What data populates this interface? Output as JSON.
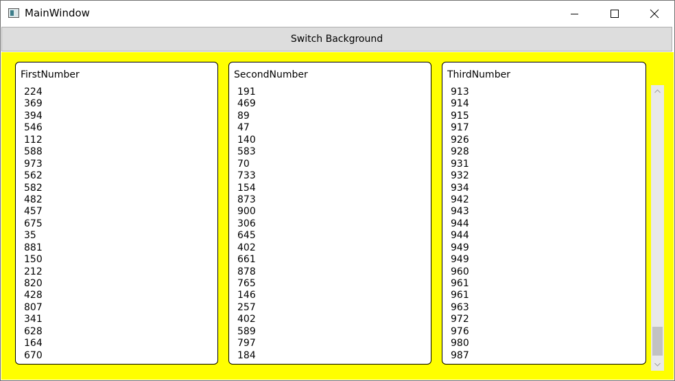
{
  "window": {
    "title": "MainWindow",
    "icon": "app-window-icon"
  },
  "titlebar_buttons": {
    "minimize_icon": "minimize-icon",
    "maximize_icon": "maximize-icon",
    "close_icon": "close-icon"
  },
  "toolbar": {
    "switch_label": "Switch Background"
  },
  "colors": {
    "content_background": "#ffff00",
    "button_background": "#dddddd"
  },
  "panels": [
    {
      "header": "FirstNumber",
      "values": [
        "224",
        "369",
        "394",
        "546",
        "112",
        "588",
        "973",
        "562",
        "582",
        "482",
        "457",
        "675",
        "35",
        "881",
        "150",
        "212",
        "820",
        "428",
        "807",
        "341",
        "628",
        "164",
        "670"
      ]
    },
    {
      "header": "SecondNumber",
      "values": [
        "191",
        "469",
        "89",
        "47",
        "140",
        "583",
        "70",
        "733",
        "154",
        "873",
        "900",
        "306",
        "645",
        "402",
        "661",
        "878",
        "765",
        "146",
        "257",
        "402",
        "589",
        "797",
        "184"
      ]
    },
    {
      "header": "ThirdNumber",
      "values": [
        "913",
        "914",
        "915",
        "917",
        "926",
        "928",
        "931",
        "932",
        "934",
        "942",
        "943",
        "944",
        "944",
        "949",
        "949",
        "960",
        "961",
        "961",
        "963",
        "972",
        "976",
        "980",
        "987"
      ]
    }
  ]
}
